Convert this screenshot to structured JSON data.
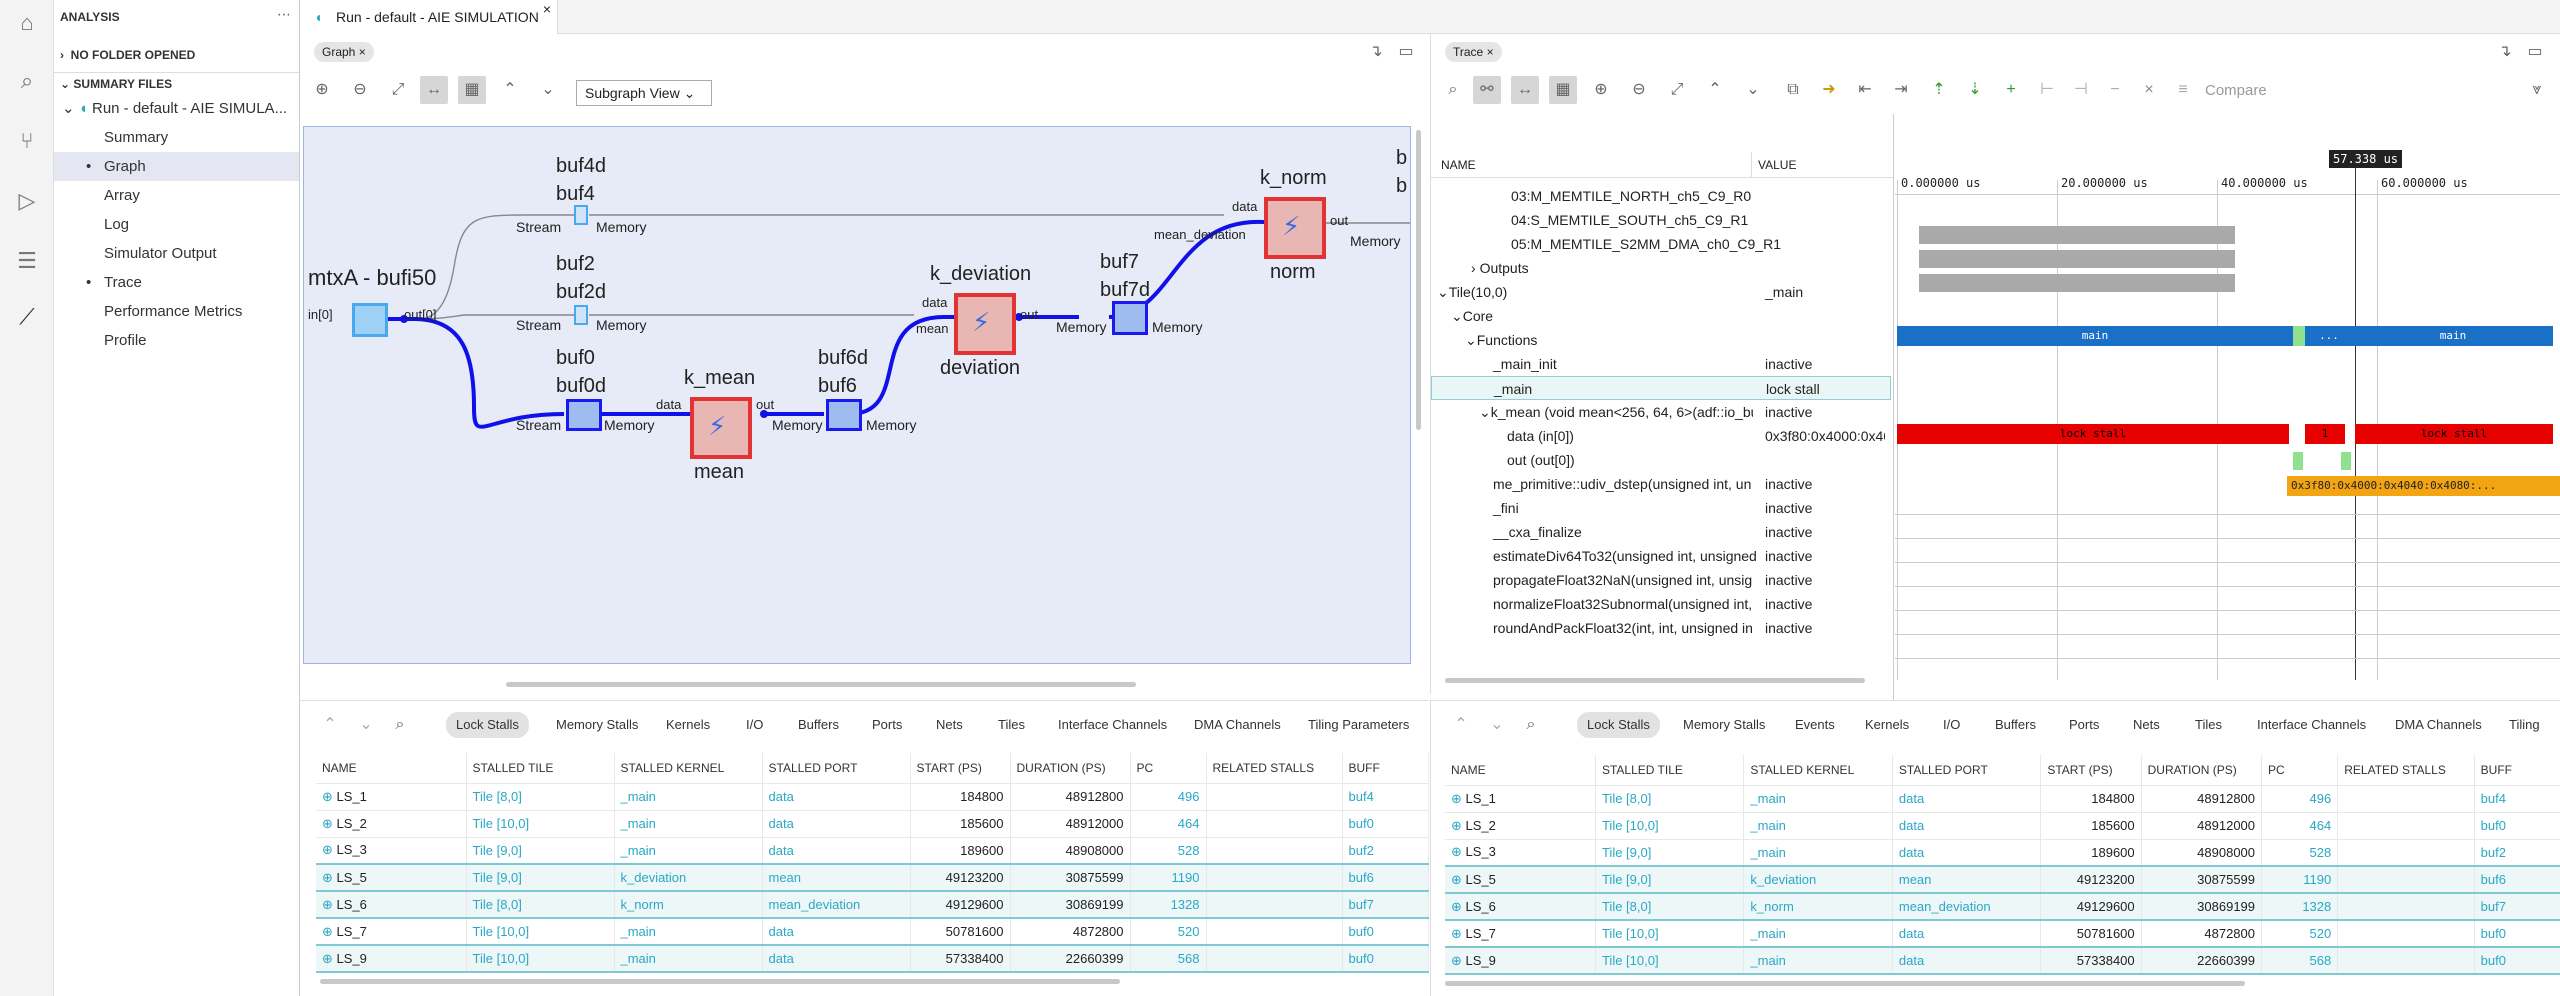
{
  "sidebar": {
    "title": "ANALYSIS",
    "no_folder": "NO FOLDER OPENED",
    "summary_files": "SUMMARY FILES",
    "run_root": "Run - default - AIE SIMULA...",
    "items": [
      {
        "label": "Summary"
      },
      {
        "label": "Graph"
      },
      {
        "label": "Array"
      },
      {
        "label": "Log"
      },
      {
        "label": "Simulator Output"
      },
      {
        "label": "Trace"
      },
      {
        "label": "Performance Metrics"
      },
      {
        "label": "Profile"
      }
    ]
  },
  "editor": {
    "tab_title": "Run - default - AIE SIMULATION"
  },
  "graph": {
    "chip": "Graph",
    "view_select": "Subgraph View",
    "labels": {
      "buf4d": "buf4d",
      "buf4": "buf4",
      "buf2": "buf2",
      "buf2d": "buf2d",
      "buf0": "buf0",
      "buf0d": "buf0d",
      "buf6d": "buf6d",
      "buf6": "buf6",
      "buf7": "buf7",
      "buf7d": "buf7d",
      "k_norm": "k_norm",
      "norm": "norm",
      "k_deviation": "k_deviation",
      "deviation": "deviation",
      "k_mean": "k_mean",
      "mean": "mean",
      "mtxA": "mtxA - bufi50",
      "in0": "in[0]",
      "out0": "out[0]",
      "stream": "Stream",
      "memory": "Memory",
      "data": "data",
      "out": "out",
      "mean_port": "mean",
      "mean_deviation": "mean_deviation",
      "b": "b"
    }
  },
  "trace": {
    "chip": "Trace",
    "compare": "Compare",
    "time_marker": "57.338 us",
    "col_name": "NAME",
    "col_value": "VALUE",
    "ticks": [
      "0.000000 us",
      "20.000000 us",
      "40.000000 us",
      "60.000000 us"
    ],
    "rows": [
      {
        "name": "03:M_MEMTILE_NORTH_ch5_C9_R0",
        "value": ""
      },
      {
        "name": "04:S_MEMTILE_SOUTH_ch5_C9_R1",
        "value": ""
      },
      {
        "name": "05:M_MEMTILE_S2MM_DMA_ch0_C9_R1",
        "value": ""
      },
      {
        "name": "Outputs",
        "value": ""
      },
      {
        "name": "Tile(10,0)",
        "value": "_main"
      },
      {
        "name": "Core",
        "value": ""
      },
      {
        "name": "Functions",
        "value": ""
      },
      {
        "name": "_main_init",
        "value": "inactive"
      },
      {
        "name": "_main",
        "value": "lock stall"
      },
      {
        "name": "k_mean (void mean<256, 64, 6>(adf::io_bu",
        "value": "inactive"
      },
      {
        "name": "data (in[0])",
        "value": "0x3f80:0x4000:0x404"
      },
      {
        "name": "out (out[0])",
        "value": ""
      },
      {
        "name": "me_primitive::udiv_dstep(unsigned int, un",
        "value": "inactive"
      },
      {
        "name": "_fini",
        "value": "inactive"
      },
      {
        "name": "__cxa_finalize",
        "value": "inactive"
      },
      {
        "name": "estimateDiv64To32(unsigned int, unsigned",
        "value": "inactive"
      },
      {
        "name": "propagateFloat32NaN(unsigned int, unsig",
        "value": "inactive"
      },
      {
        "name": "normalizeFloat32Subnormal(unsigned int,",
        "value": "inactive"
      },
      {
        "name": "roundAndPackFloat32(int, int, unsigned in",
        "value": "inactive"
      }
    ],
    "wave_main": "main",
    "wave_stall": "lock stall",
    "wave_dots": "...",
    "wave_one": "1",
    "wave_data": "0x3f80:0x4000:0x4040:0x4080:..."
  },
  "stall_tabs_left": [
    "Lock Stalls",
    "Memory Stalls",
    "Kernels",
    "I/O",
    "Buffers",
    "Ports",
    "Nets",
    "Tiles",
    "Interface Channels",
    "DMA Channels",
    "Tiling Parameters"
  ],
  "stall_tabs_right": [
    "Lock Stalls",
    "Memory Stalls",
    "Events",
    "Kernels",
    "I/O",
    "Buffers",
    "Ports",
    "Nets",
    "Tiles",
    "Interface Channels",
    "DMA Channels",
    "Tiling"
  ],
  "stall_table": {
    "headers": [
      "NAME",
      "STALLED TILE",
      "STALLED KERNEL",
      "STALLED PORT",
      "START (PS)",
      "DURATION (PS)",
      "PC",
      "RELATED STALLS",
      "BUFF"
    ],
    "rows": [
      {
        "name": "LS_1",
        "tile": "Tile [8,0]",
        "kernel": "_main",
        "port": "data",
        "start": "184800",
        "duration": "48912800",
        "pc": "496",
        "buf": "buf4"
      },
      {
        "name": "LS_2",
        "tile": "Tile [10,0]",
        "kernel": "_main",
        "port": "data",
        "start": "185600",
        "duration": "48912000",
        "pc": "464",
        "buf": "buf0"
      },
      {
        "name": "LS_3",
        "tile": "Tile [9,0]",
        "kernel": "_main",
        "port": "data",
        "start": "189600",
        "duration": "48908000",
        "pc": "528",
        "buf": "buf2"
      },
      {
        "name": "LS_5",
        "tile": "Tile [9,0]",
        "kernel": "k_deviation",
        "port": "mean",
        "start": "49123200",
        "duration": "30875599",
        "pc": "1190",
        "buf": "buf6"
      },
      {
        "name": "LS_6",
        "tile": "Tile [8,0]",
        "kernel": "k_norm",
        "port": "mean_deviation",
        "start": "49129600",
        "duration": "30869199",
        "pc": "1328",
        "buf": "buf7"
      },
      {
        "name": "LS_7",
        "tile": "Tile [10,0]",
        "kernel": "_main",
        "port": "data",
        "start": "50781600",
        "duration": "4872800",
        "pc": "520",
        "buf": "buf0"
      },
      {
        "name": "LS_9",
        "tile": "Tile [10,0]",
        "kernel": "_main",
        "port": "data",
        "start": "57338400",
        "duration": "22660399",
        "pc": "568",
        "buf": "buf0"
      }
    ]
  }
}
